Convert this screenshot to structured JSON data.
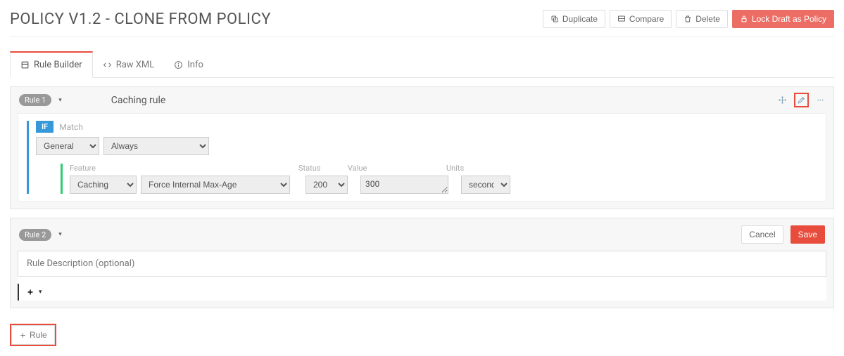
{
  "header": {
    "title": "POLICY V1.2 - CLONE FROM POLICY",
    "buttons": {
      "duplicate": "Duplicate",
      "compare": "Compare",
      "delete": "Delete",
      "lock": "Lock Draft as Policy"
    }
  },
  "tabs": {
    "builder": "Rule Builder",
    "rawxml": "Raw XML",
    "info": "Info"
  },
  "rule1": {
    "badge": "Rule 1",
    "name": "Caching rule",
    "if_badge": "IF",
    "match_label": "Match",
    "match_category": "General",
    "match_condition": "Always",
    "feature": {
      "labels": {
        "feature": "Feature",
        "status": "Status",
        "value": "Value",
        "units": "Units"
      },
      "category": "Caching",
      "name": "Force Internal Max-Age",
      "status": "200",
      "value": "300",
      "units": "seconds"
    }
  },
  "rule2": {
    "badge": "Rule 2",
    "desc_placeholder": "Rule Description (optional)",
    "cancel": "Cancel",
    "save": "Save"
  },
  "footer": {
    "add_rule": "Rule"
  }
}
